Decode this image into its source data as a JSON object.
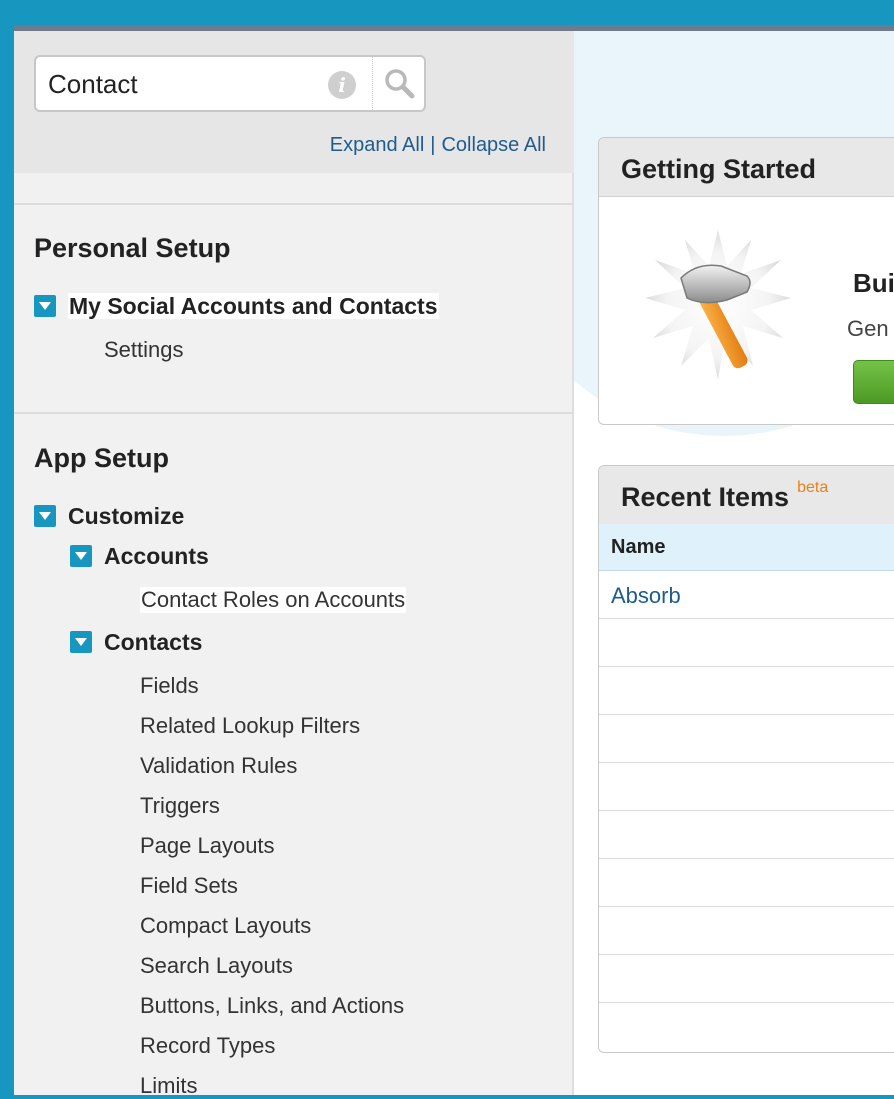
{
  "search": {
    "value": "Contact"
  },
  "tree_links": {
    "expand_all": "Expand All",
    "separator": "|",
    "collapse_all": "Collapse All"
  },
  "personal_setup": {
    "title": "Personal Setup",
    "group": "My Social Accounts and Contacts",
    "items": [
      "Settings"
    ]
  },
  "app_setup": {
    "title": "App Setup",
    "customize": "Customize",
    "accounts": {
      "label": "Accounts",
      "items": [
        "Contact Roles on Accounts"
      ]
    },
    "contacts": {
      "label": "Contacts",
      "items": [
        "Fields",
        "Related Lookup Filters",
        "Validation Rules",
        "Triggers",
        "Page Layouts",
        "Field Sets",
        "Compact Layouts",
        "Search Layouts",
        "Buttons, Links, and Actions",
        "Record Types",
        "Limits"
      ]
    }
  },
  "getting_started": {
    "title": "Getting Started",
    "heading": "Bui",
    "description": "Gen"
  },
  "recent_items": {
    "title": "Recent Items",
    "badge": "beta",
    "column": "Name",
    "rows": [
      "Absorb",
      "",
      "",
      "",
      "",
      "",
      "",
      "",
      "",
      ""
    ]
  },
  "colors": {
    "accent": "#1797c0",
    "link": "#1e5c8f",
    "button_green": "#5aae32",
    "beta_orange": "#e8821a"
  },
  "icons": [
    "info-icon",
    "search-icon",
    "hammer-icon",
    "triangle-down-icon"
  ]
}
